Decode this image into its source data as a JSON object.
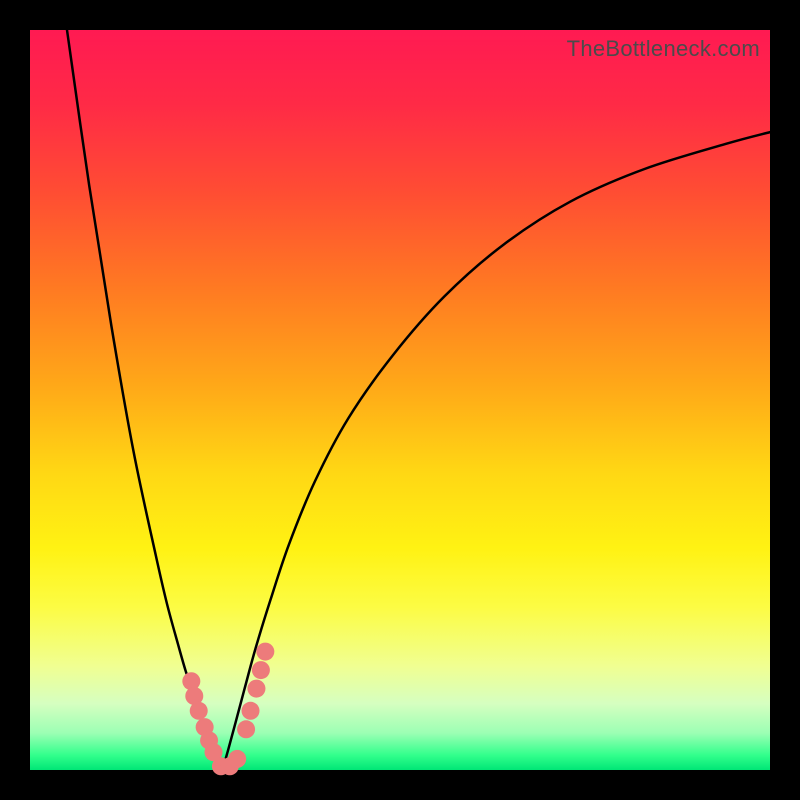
{
  "watermark": "TheBottleneck.com",
  "chart_data": {
    "type": "line",
    "title": "",
    "xlabel": "",
    "ylabel": "",
    "xlim": [
      0,
      1
    ],
    "ylim": [
      0,
      1
    ],
    "series": [
      {
        "name": "left-branch",
        "x": [
          0.05,
          0.08,
          0.11,
          0.14,
          0.17,
          0.185,
          0.2,
          0.21,
          0.22,
          0.228,
          0.236,
          0.242,
          0.248,
          0.254,
          0.26
        ],
        "y": [
          1.0,
          0.79,
          0.6,
          0.43,
          0.29,
          0.225,
          0.17,
          0.135,
          0.105,
          0.08,
          0.058,
          0.04,
          0.024,
          0.01,
          0.0
        ]
      },
      {
        "name": "right-branch",
        "x": [
          0.26,
          0.268,
          0.278,
          0.29,
          0.305,
          0.325,
          0.35,
          0.385,
          0.43,
          0.49,
          0.56,
          0.64,
          0.73,
          0.83,
          0.94,
          1.0
        ],
        "y": [
          0.0,
          0.028,
          0.065,
          0.11,
          0.165,
          0.23,
          0.305,
          0.39,
          0.475,
          0.56,
          0.64,
          0.71,
          0.768,
          0.812,
          0.846,
          0.862
        ]
      }
    ],
    "markers": [
      {
        "x": 0.218,
        "y": 0.12
      },
      {
        "x": 0.222,
        "y": 0.1
      },
      {
        "x": 0.228,
        "y": 0.08
      },
      {
        "x": 0.236,
        "y": 0.058
      },
      {
        "x": 0.242,
        "y": 0.04
      },
      {
        "x": 0.248,
        "y": 0.024
      },
      {
        "x": 0.258,
        "y": 0.005
      },
      {
        "x": 0.27,
        "y": 0.005
      },
      {
        "x": 0.28,
        "y": 0.015
      },
      {
        "x": 0.292,
        "y": 0.055
      },
      {
        "x": 0.298,
        "y": 0.08
      },
      {
        "x": 0.306,
        "y": 0.11
      },
      {
        "x": 0.312,
        "y": 0.135
      },
      {
        "x": 0.318,
        "y": 0.16
      }
    ],
    "marker_color": "#ed7b7b",
    "curve_color": "#000000",
    "curve_width": 2.5
  }
}
